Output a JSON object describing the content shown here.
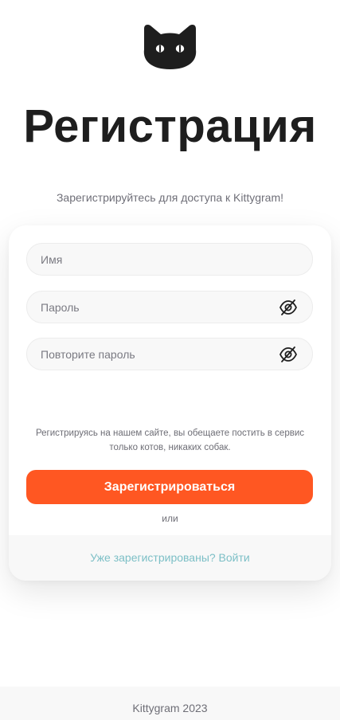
{
  "logo": {
    "icon": "cat-head-icon",
    "color": "#1e1e1e"
  },
  "header": {
    "title": "Регистрация",
    "subtitle": "Зарегистрируйтесь для доступа к Kittygram!"
  },
  "form": {
    "fields": [
      {
        "name": "username",
        "placeholder": "Имя",
        "value": "",
        "type": "text"
      },
      {
        "name": "password",
        "placeholder": "Пароль",
        "value": "",
        "type": "password",
        "toggle_icon": "eye-off-icon"
      },
      {
        "name": "password_repeat",
        "placeholder": "Повторите пароль",
        "value": "",
        "type": "password",
        "toggle_icon": "eye-off-icon"
      }
    ],
    "note": "Регистрируясь на нашем сайте, вы обещаете постить в сервис только котов, никаких собак.",
    "submit_label": "Зарегистрироваться",
    "or_label": "или",
    "login_link": "Уже зарегистрированы? Войти"
  },
  "footer": {
    "text": "Kittygram 2023"
  },
  "colors": {
    "accent": "#ff5722",
    "link": "#7cbfc6",
    "field_bg": "#f8f8f8",
    "text_muted": "#6e6e76"
  }
}
